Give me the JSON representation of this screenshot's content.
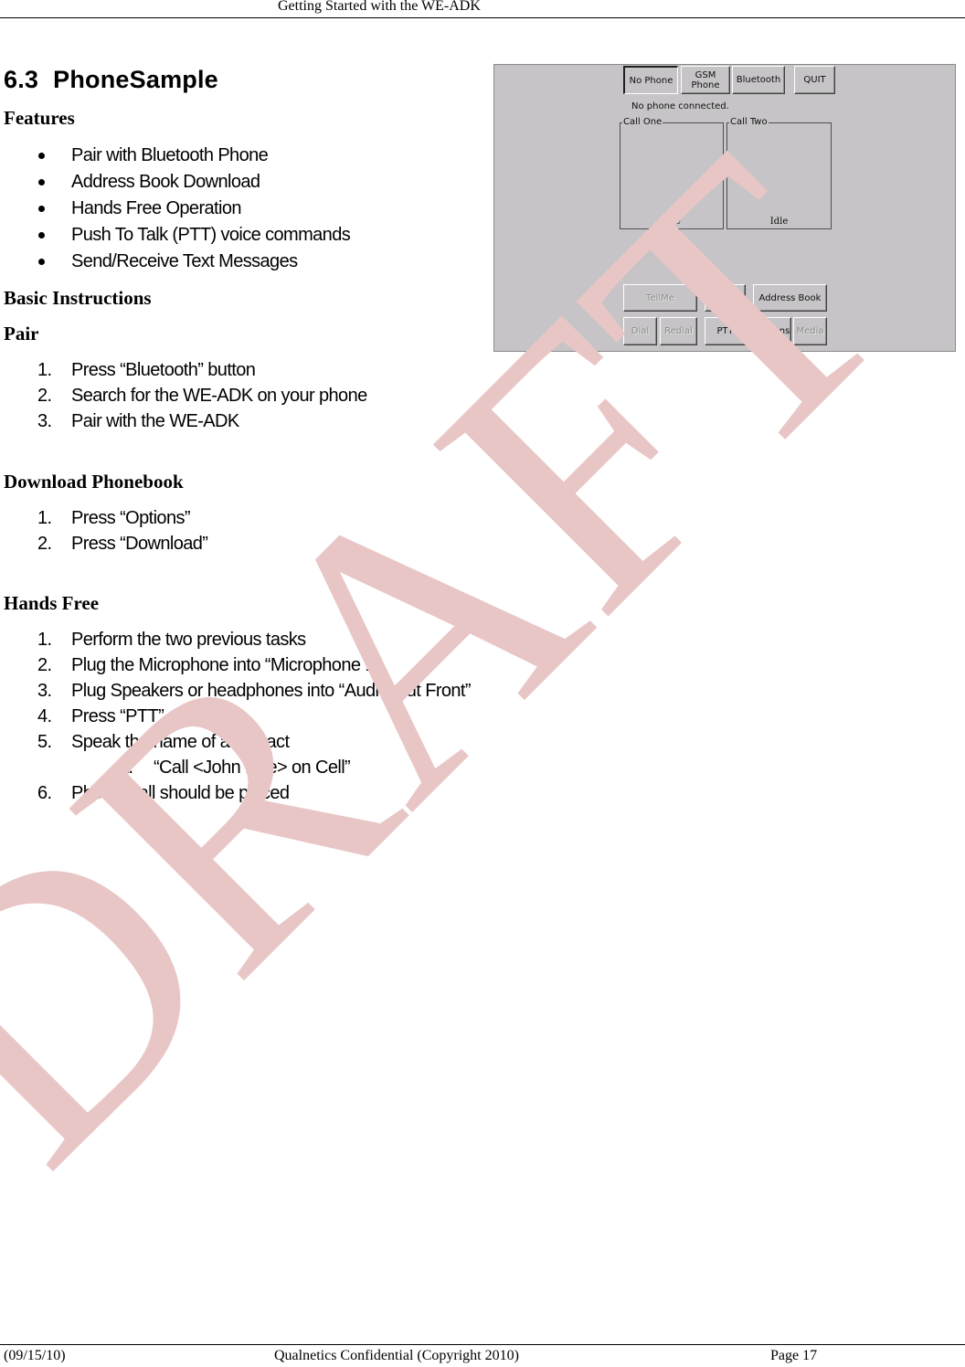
{
  "header": {
    "title": "Getting Started with the WE-ADK"
  },
  "section": {
    "number": "6.3",
    "title": "PhoneSample"
  },
  "features": {
    "heading": "Features",
    "items": [
      "Pair with Bluetooth Phone",
      "Address Book Download",
      "Hands Free Operation",
      "Push To Talk (PTT) voice commands",
      "Send/Receive Text Messages"
    ]
  },
  "basic_instructions": {
    "heading": "Basic Instructions"
  },
  "pair": {
    "heading": "Pair",
    "steps": [
      {
        "n": "1.",
        "text": "Press “Bluetooth” button"
      },
      {
        "n": "2.",
        "text": "Search for the WE-ADK on your phone"
      },
      {
        "n": "3.",
        "text": "Pair with the WE-ADK"
      }
    ]
  },
  "download_phonebook": {
    "heading": "Download Phonebook",
    "steps": [
      {
        "n": "1.",
        "text": "Press “Options”"
      },
      {
        "n": "2.",
        "text": "Press “Download”"
      }
    ]
  },
  "hands_free": {
    "heading": "Hands Free",
    "steps": [
      {
        "n": "1.",
        "text": "Perform the two previous tasks"
      },
      {
        "n": "2.",
        "text": "Plug the Microphone into “Microphone 1”"
      },
      {
        "n": "3.",
        "text": "Plug Speakers or headphones into “Audio Out Front”"
      },
      {
        "n": "4.",
        "text": "Press “PTT”"
      },
      {
        "n": "5.",
        "text": "Speak the name of a contact"
      },
      {
        "n": "a.",
        "text": "“Call <John Doe> on Cell”"
      },
      {
        "n": "6.",
        "text": "Phone Call should be placed"
      }
    ]
  },
  "app": {
    "buttons_top": {
      "no_phone": "No Phone",
      "gsm_phone_1": "GSM",
      "gsm_phone_2": "Phone",
      "bluetooth": "Bluetooth",
      "quit": "QUIT"
    },
    "status": "No phone connected.",
    "call_one": {
      "label": "Call One",
      "state": "Idle"
    },
    "call_two": {
      "label": "Call Two",
      "state": "Idle"
    },
    "buttons_bottom": {
      "tellme": "TellMe",
      "sms": "SMS",
      "address_book": "Address Book",
      "dial": "Dial",
      "redial": "Redial",
      "ptt": "PTT",
      "options": "Options",
      "media": "Media"
    }
  },
  "watermark": {
    "text": "DRAFT",
    "color": "#e9c6c6"
  },
  "footer": {
    "date": "(09/15/10)",
    "confidential": "Qualnetics Confidential (Copyright 2010)",
    "page": "Page 17"
  }
}
